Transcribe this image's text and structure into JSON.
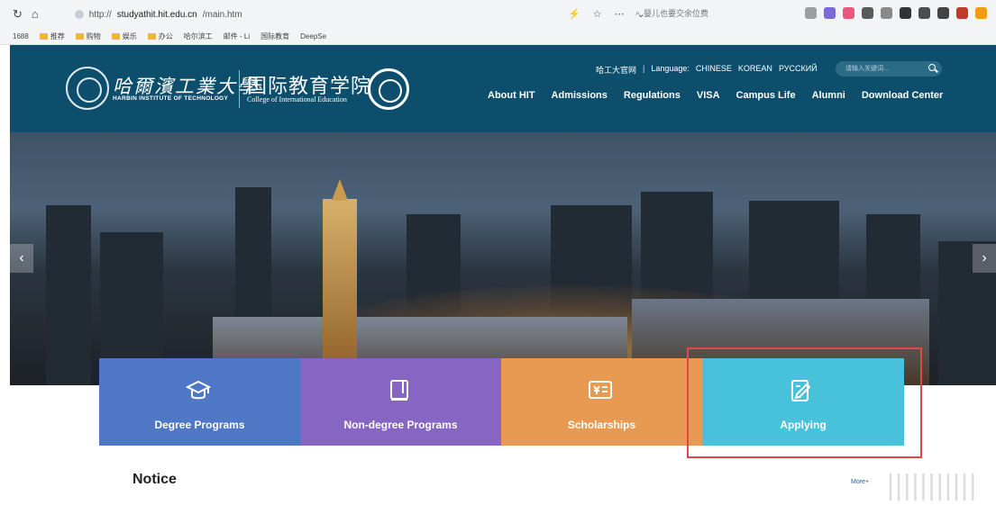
{
  "browser": {
    "url_prefix": "http://",
    "url_host": "studyathit.hit.edu.cn",
    "url_path": "/main.htm",
    "search_hint": "婴儿也要交余位费",
    "bookmarks": [
      "1688",
      "推荐",
      "购物",
      "娱乐",
      "办公",
      "哈尔滨工",
      "邮件 - Li",
      "国际教育",
      "DeepSe"
    ]
  },
  "header": {
    "university_cn": "哈爾濱工業大學",
    "university_en": "HARBIN INSTITUTE OF TECHNOLOGY",
    "college_cn": "国际教育学院",
    "college_en": "College of International Education",
    "official_site_link": "哈工大官网",
    "language_label": "Language:",
    "languages": [
      "CHINESE",
      "KOREAN",
      "РУССКИЙ"
    ],
    "search_placeholder": "请输入关键词..."
  },
  "nav": [
    "About HIT",
    "Admissions",
    "Regulations",
    "VISA",
    "Campus Life",
    "Alumni",
    "Download Center"
  ],
  "tiles": [
    {
      "label": "Degree Programs",
      "icon": "graduation-cap-icon",
      "color": "#4e77c6"
    },
    {
      "label": "Non-degree Programs",
      "icon": "book-icon",
      "color": "#8765c3"
    },
    {
      "label": "Scholarships",
      "icon": "scholarship-card-icon",
      "color": "#e99a52"
    },
    {
      "label": "Applying",
      "icon": "edit-document-icon",
      "color": "#48c2da"
    }
  ],
  "notice": {
    "title": "Notice",
    "more_label": "More+"
  },
  "colors": {
    "header_bg": "#0d4e6c",
    "highlight_border": "#e04848"
  }
}
